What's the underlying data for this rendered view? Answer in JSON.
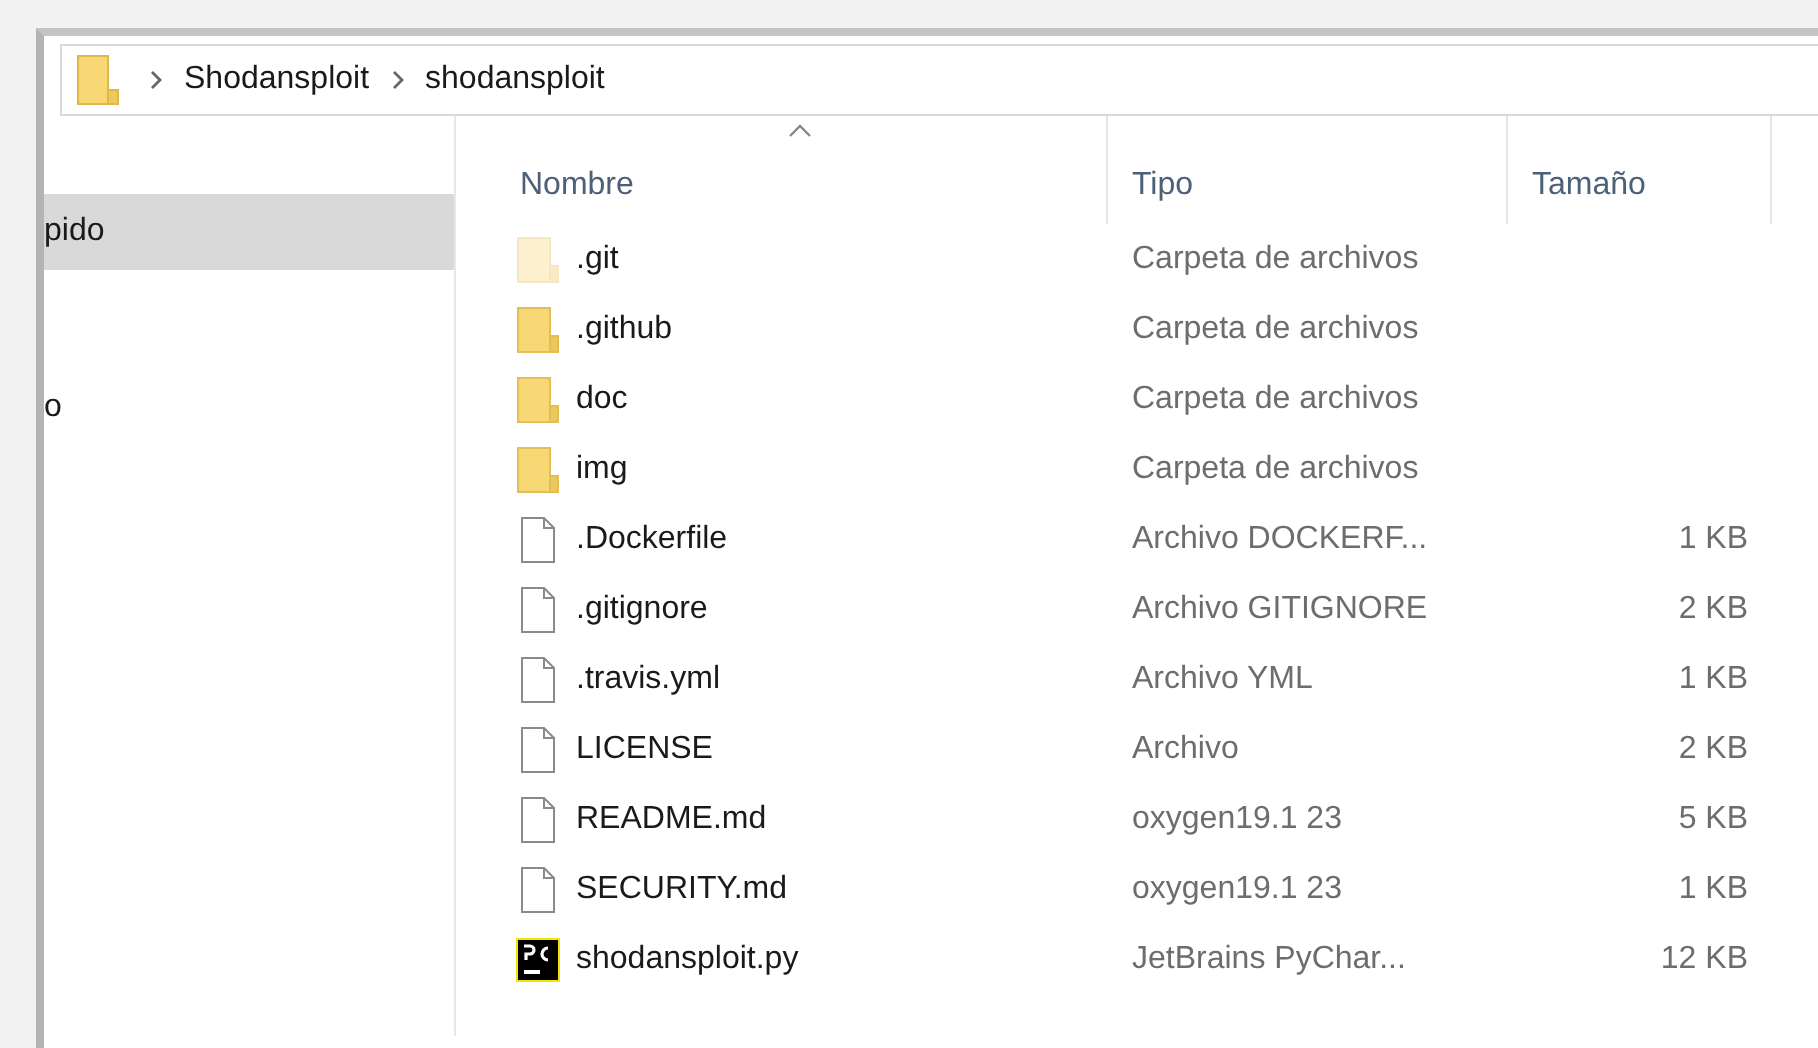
{
  "breadcrumb": [
    "Shodansploit",
    "shodansploit"
  ],
  "sidebar": {
    "items": [
      {
        "label": "pido",
        "selected": true
      },
      {
        "label": "o",
        "selected": false
      }
    ]
  },
  "table": {
    "columns": [
      {
        "label": "Nombre",
        "sorted": true
      },
      {
        "label": "Tipo",
        "sorted": false
      },
      {
        "label": "Tamaño",
        "sorted": false
      }
    ],
    "rows": [
      {
        "name": ".git",
        "kind": "folder",
        "hidden": true,
        "type": "Carpeta de archivos"
      },
      {
        "name": ".github",
        "kind": "folder",
        "hidden": false,
        "type": "Carpeta de archivos"
      },
      {
        "name": "doc",
        "kind": "folder",
        "hidden": false,
        "type": "Carpeta de archivos"
      },
      {
        "name": "img",
        "kind": "folder",
        "hidden": false,
        "type": "Carpeta de archivos"
      },
      {
        "name": ".Dockerfile",
        "kind": "file",
        "type": "Archivo DOCKERF...",
        "size": "1 KB"
      },
      {
        "name": ".gitignore",
        "kind": "file",
        "type": "Archivo GITIGNORE",
        "size": "2 KB"
      },
      {
        "name": ".travis.yml",
        "kind": "file",
        "type": "Archivo YML",
        "size": "1 KB"
      },
      {
        "name": "LICENSE",
        "kind": "file",
        "type": "Archivo",
        "size": "2 KB"
      },
      {
        "name": "README.md",
        "kind": "file",
        "type": "oxygen19.1 23",
        "size": "5 KB"
      },
      {
        "name": "SECURITY.md",
        "kind": "file",
        "type": "oxygen19.1 23",
        "size": "1 KB"
      },
      {
        "name": "shodansploit.py",
        "kind": "app",
        "type": "JetBrains PyChar...",
        "size": "12 KB"
      }
    ]
  }
}
